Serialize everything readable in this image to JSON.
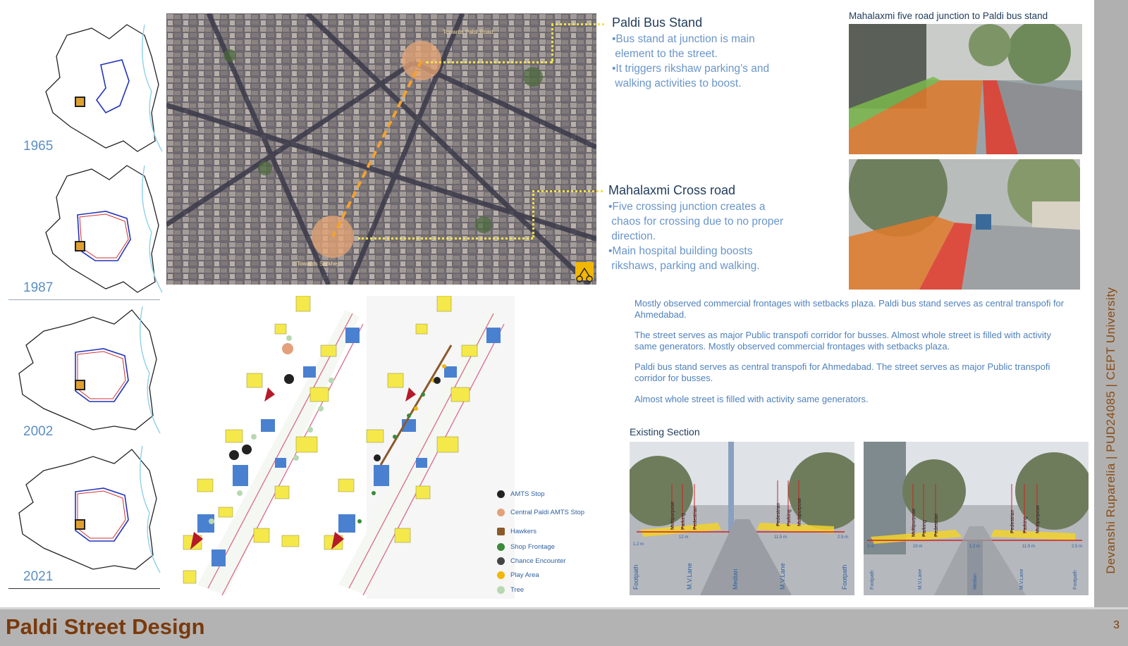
{
  "timeline": {
    "years": [
      "1965",
      "1987",
      "2002",
      "2021"
    ]
  },
  "aerial": {
    "label_top": "Towards Paldi Road",
    "label_bottom": "Towards Sarkhej"
  },
  "callouts": [
    {
      "title": "Paldi Bus Stand",
      "bullets": [
        "•Bus stand at junction is main",
        " element to the street.",
        "•It triggers rikshaw parking’s and",
        " walking activities to boost."
      ]
    },
    {
      "title": "Mahalaxmi Cross road",
      "bullets": [
        "•Five crossing junction creates a",
        " chaos for crossing due to no proper",
        " direction.",
        "•Main hospital building boosts",
        " rikshaws, parking and walking."
      ]
    }
  ],
  "photo_caption": "Mahalaxmi five road junction to Paldi bus stand",
  "paragraphs": [
    "Mostly observed commercial frontages with setbacks plaza. Paldi bus stand serves as central transpofi for Ahmedabad.",
    "The street serves as major Public transpofi corridor for busses. Almost whole street is filled with activity same generators. Mostly observed commercial frontages with setbacks plaza.",
    "Paldi bus stand serves as central transpofi for Ahmedabad. The street serves as major Public transpofi corridor for busses.",
    "Almost whole street is filled with activity same generators."
  ],
  "legend": [
    {
      "label": "AMTS Stop",
      "color": "#222222"
    },
    {
      "label": "Central Paldi AMTS Stop",
      "color": "#e3a07a"
    },
    {
      "label": "Hawkers",
      "color": "#8a5a2b"
    },
    {
      "label": "Shop Frontage",
      "color": "#3a8a3a"
    },
    {
      "label": "Chance Encounter",
      "color": "#444444"
    },
    {
      "label": "Play Area",
      "color": "#f2b705"
    },
    {
      "label": "Tree",
      "color": "#b8d8b0"
    }
  ],
  "section": {
    "label": "Existing Section",
    "left_labels": [
      "Footpath",
      "M.V.Lane",
      "Median",
      "M.V.Lane",
      "Footpath"
    ],
    "left_top_labels": [
      "Multipurpose",
      "Parking",
      "Pedestrian",
      "Pedestrian",
      "Parking",
      "Multipurpose"
    ],
    "left_dims": [
      "12 m",
      "11.5 m",
      "2.5 m",
      "1.2 m"
    ],
    "right_labels": [
      "Footpath",
      "M.V.Lane",
      "Median",
      "M.V.Lane",
      "Footpath"
    ],
    "right_top_labels": [
      "Multipurpose",
      "Parking",
      "Pedestrian",
      "Pedestrian",
      "Parking",
      "Multipurpose"
    ],
    "right_dims": [
      "3 m",
      "10 m",
      "1.2 m",
      "11.5 m",
      "2.5 m"
    ]
  },
  "author": "Devanshi Ruparelia | PUD24085 | CEPT University",
  "footer": {
    "title": "Paldi Street Design",
    "page": "3"
  },
  "colors": {
    "title_brown": "#7a3a0c",
    "text_blue": "#6a95c9",
    "heading_navy": "#1f3b5a",
    "marker_yellow": "#f2e04a"
  }
}
